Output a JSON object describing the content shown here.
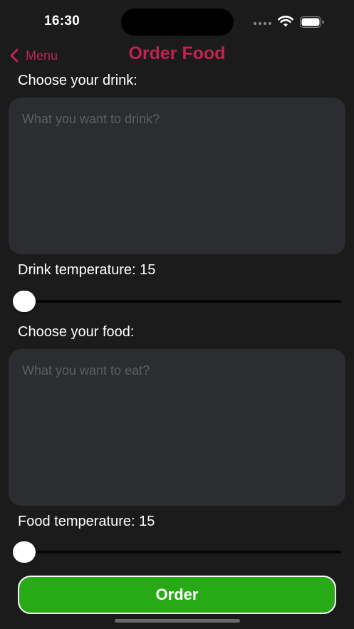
{
  "status_bar": {
    "time": "16:30",
    "icons": [
      "cellular-signal-icon",
      "wifi-icon",
      "battery-icon"
    ]
  },
  "nav": {
    "back_label": "Menu",
    "title": "Order Food",
    "accent_color": "#c2224f"
  },
  "drink": {
    "label": "Choose your drink:",
    "placeholder": "What you want to drink?",
    "value": "",
    "temperature_label": "Drink temperature: 15",
    "temperature_slider_fraction": 0
  },
  "food": {
    "label": "Choose your food:",
    "placeholder": "What you want to eat?",
    "value": "",
    "temperature_label": "Food temperature: 15",
    "temperature_slider_fraction": 0
  },
  "order_button": {
    "label": "Order",
    "color": "#28a916"
  }
}
